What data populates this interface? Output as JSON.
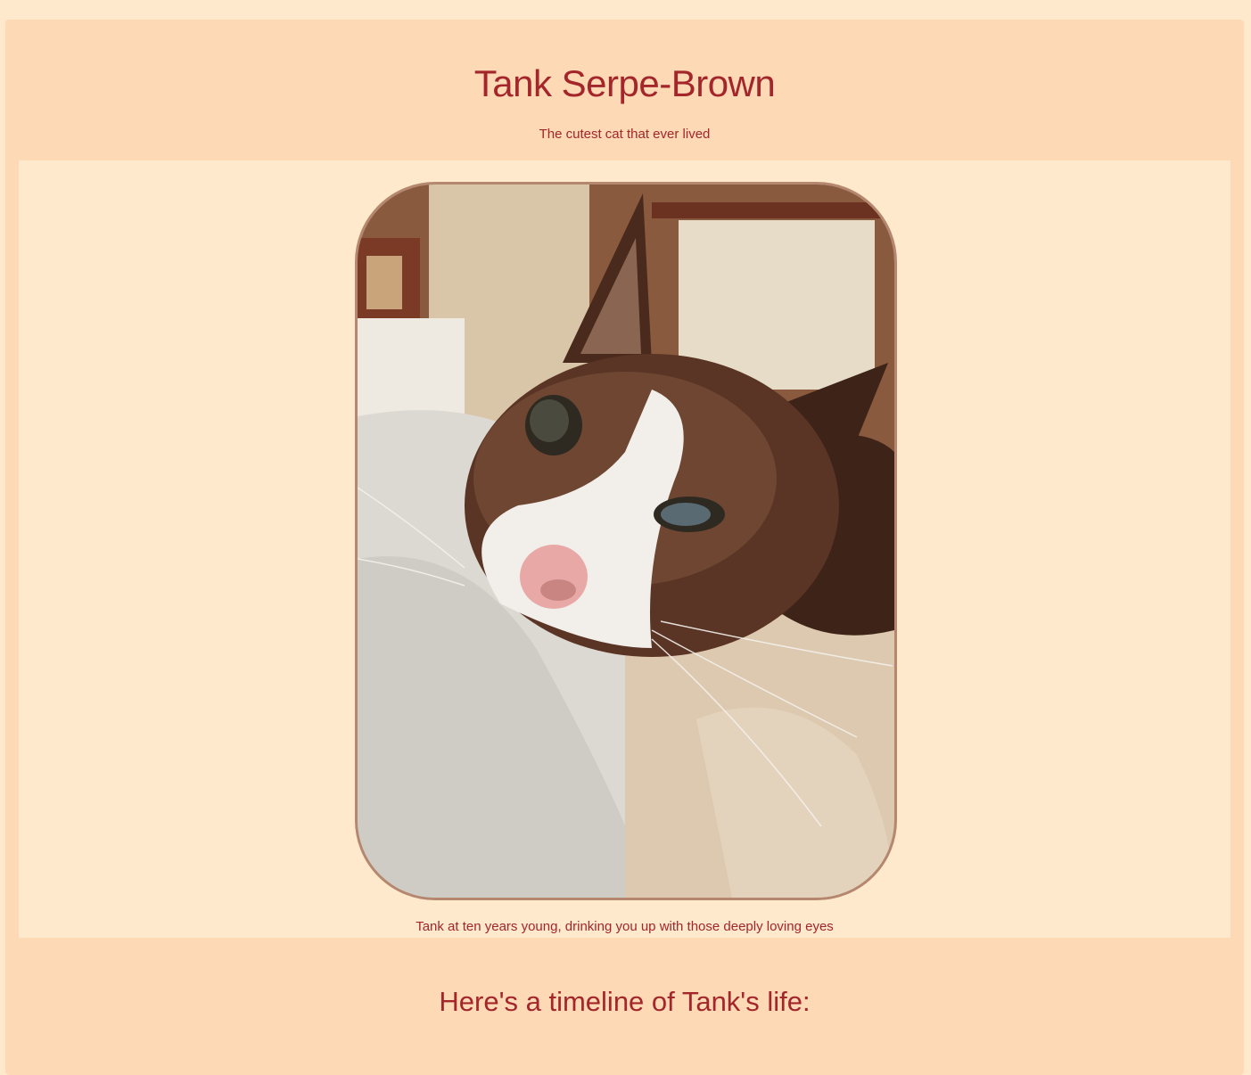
{
  "page": {
    "title": "Tank Serpe-Brown",
    "tagline": "The cutest cat that ever lived",
    "image_caption": "Tank at ten years young, drinking you up with those deeply loving eyes",
    "timeline_heading": "Here's a timeline of Tank's life:"
  },
  "colors": {
    "page_background": "#fee9cd",
    "main_background": "#fed9b6",
    "text": "#a3262a",
    "frame_border": "#b5876e"
  }
}
